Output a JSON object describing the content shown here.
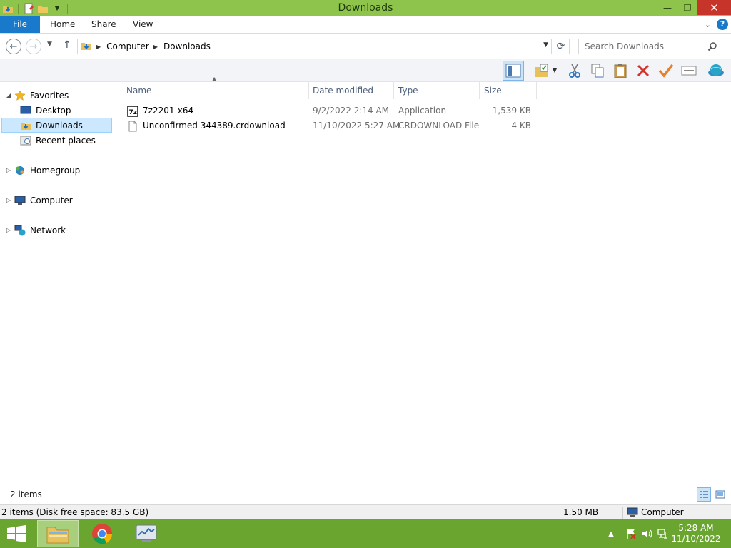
{
  "window": {
    "title": "Downloads"
  },
  "ribbon": {
    "tabs": [
      "File",
      "Home",
      "Share",
      "View"
    ]
  },
  "address": {
    "crumbs": [
      "Computer",
      "Downloads"
    ],
    "search_placeholder": "Search Downloads"
  },
  "nav_pane": {
    "favorites": {
      "label": "Favorites",
      "items": [
        "Desktop",
        "Downloads",
        "Recent places"
      ]
    },
    "homegroup": "Homegroup",
    "computer": "Computer",
    "network": "Network",
    "selected": "Downloads"
  },
  "file_list": {
    "columns": [
      "Name",
      "Date modified",
      "Type",
      "Size"
    ],
    "rows": [
      {
        "name": "7z2201-x64",
        "date": "9/2/2022 2:14 AM",
        "type": "Application",
        "size": "1,539 KB",
        "icon": "7zip-installer-icon"
      },
      {
        "name": "Unconfirmed 344389.crdownload",
        "date": "11/10/2022 5:27 AM",
        "type": "CRDOWNLOAD File",
        "size": "4 KB",
        "icon": "blank-file-icon"
      }
    ]
  },
  "status": {
    "item_count": "2 items",
    "detail": "2 items (Disk free space: 83.5 GB)",
    "size": "1.50 MB",
    "location": "Computer"
  },
  "taskbar": {
    "time": "5:28 AM",
    "date": "11/10/2022"
  },
  "colors": {
    "titlebar": "#8fc44c",
    "taskbar": "#6aa530",
    "accent": "#1979ca",
    "close": "#c7352a"
  }
}
